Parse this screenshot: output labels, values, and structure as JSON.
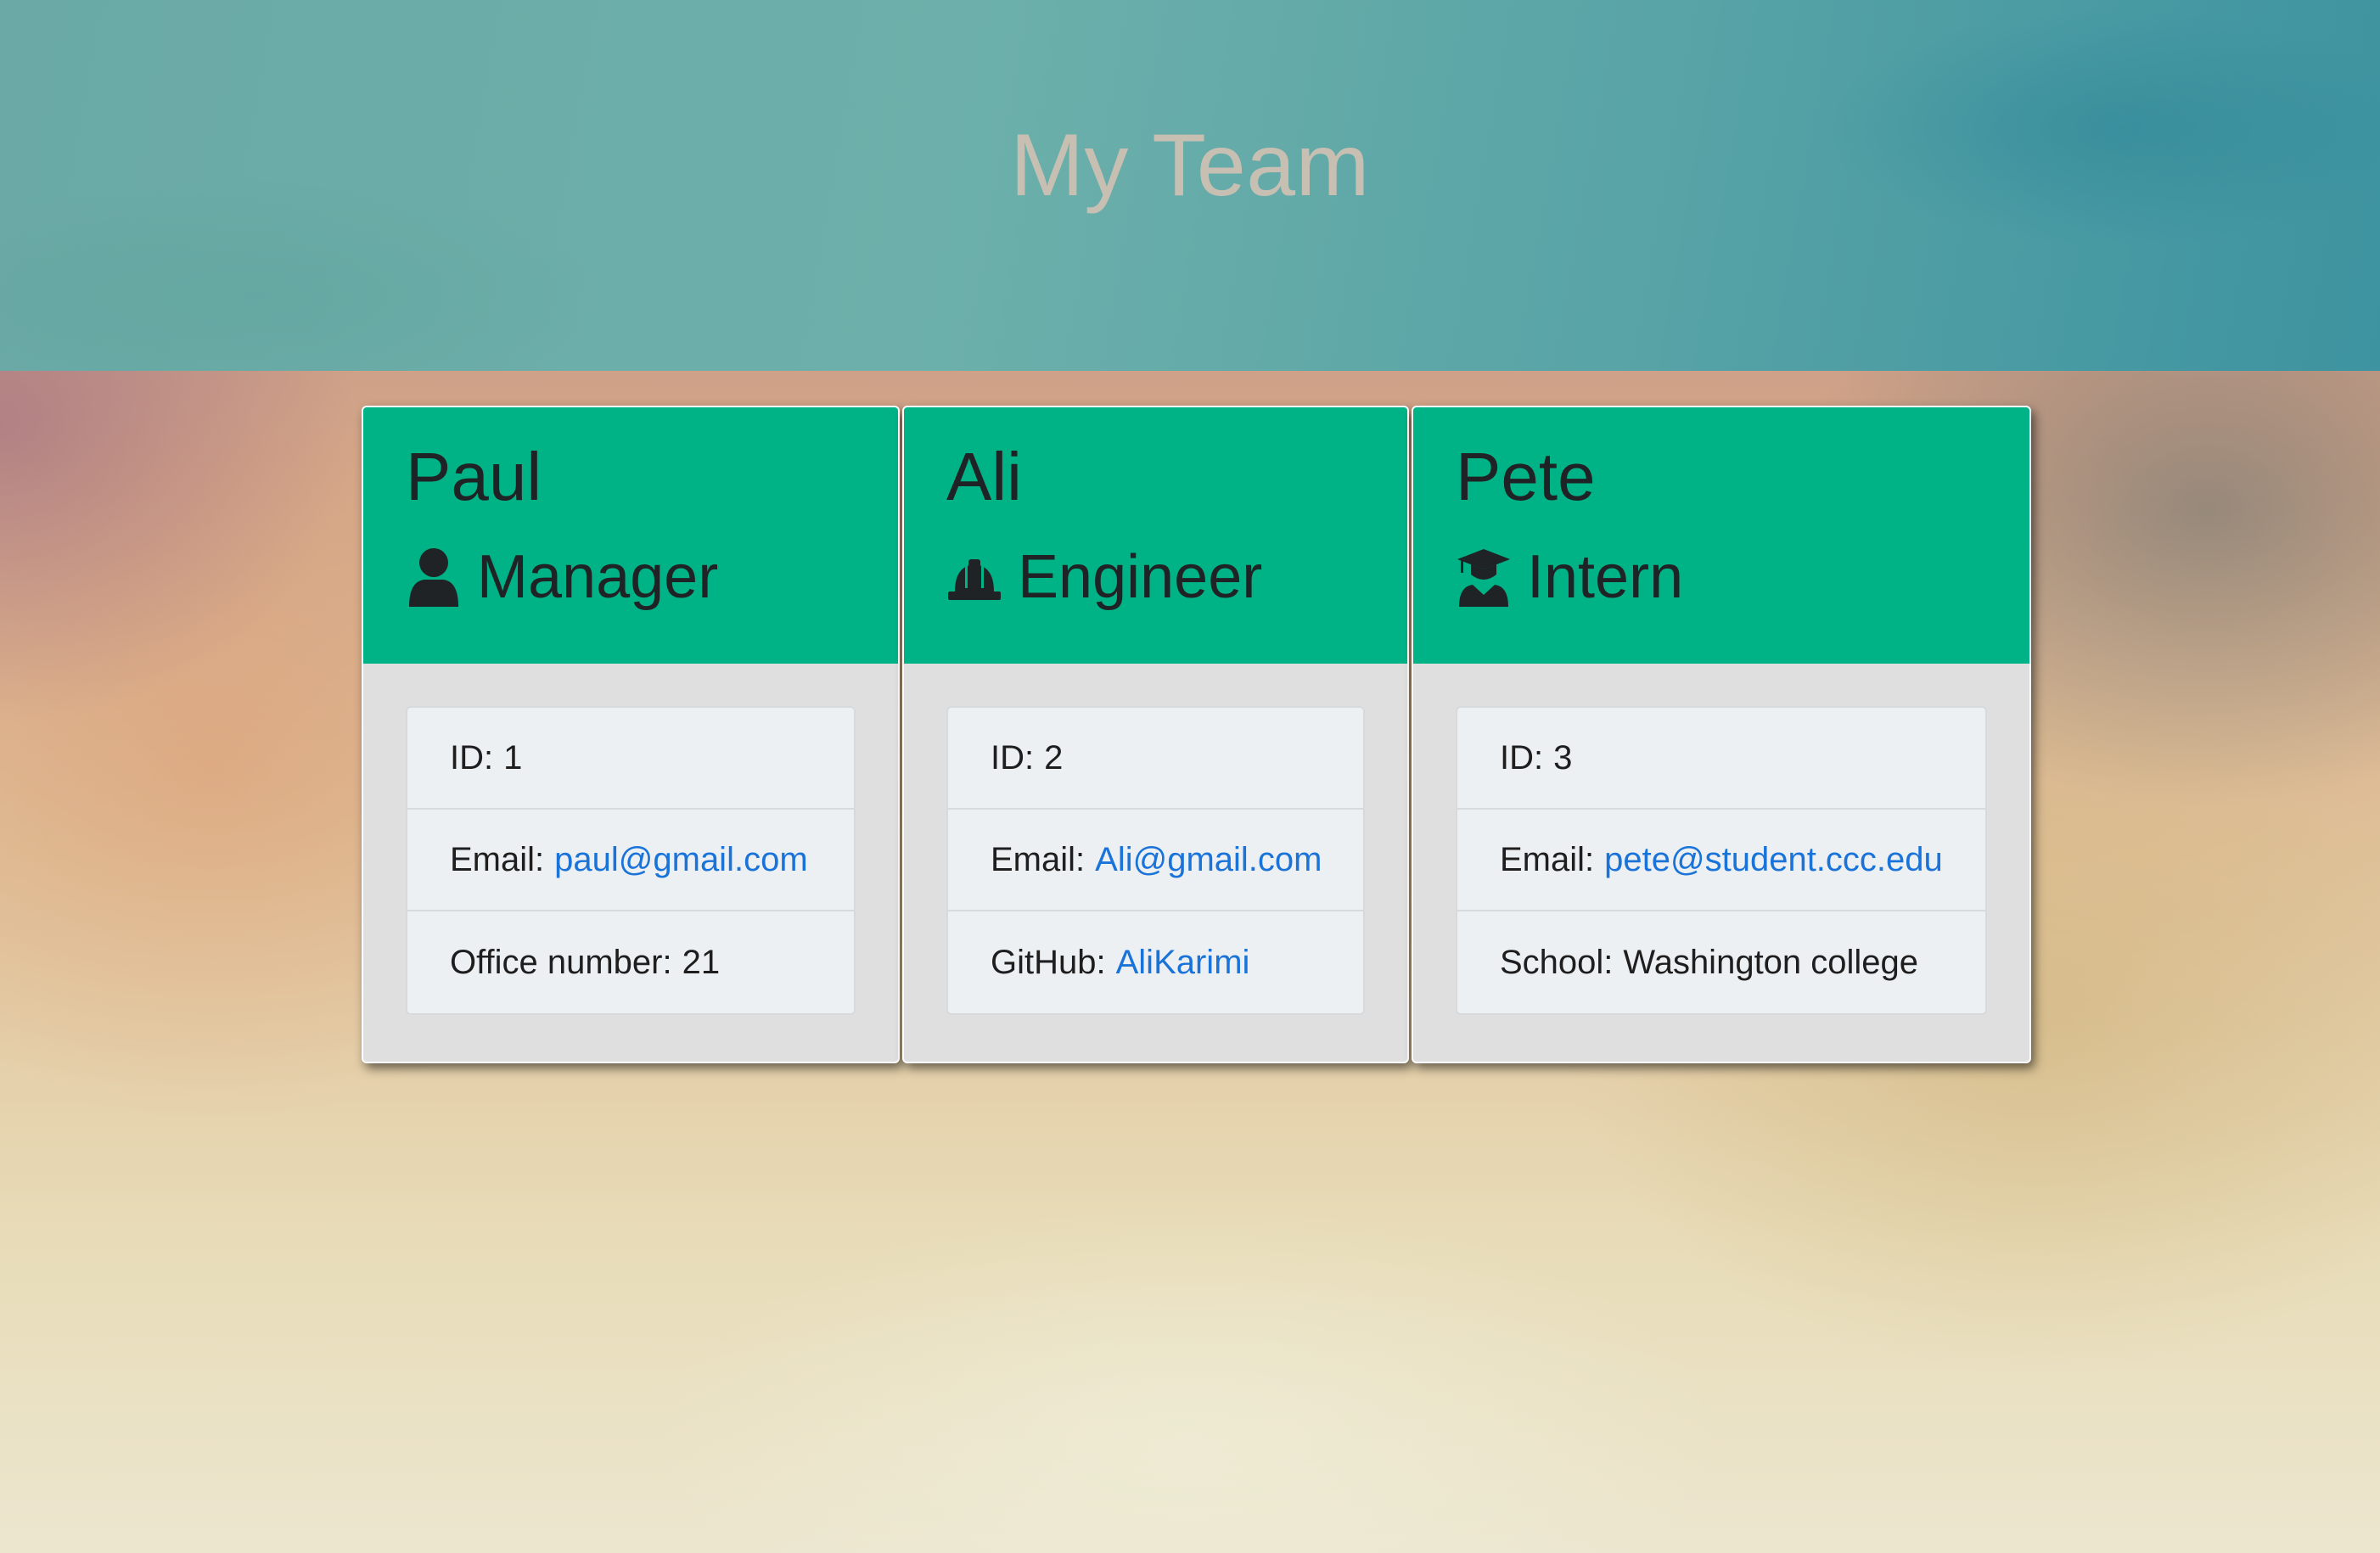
{
  "page": {
    "title": "My Team"
  },
  "team": [
    {
      "name": "Paul",
      "role": "Manager",
      "role_icon": "user-icon",
      "id_label": "ID:",
      "id_value": "1",
      "email_label": "Email:",
      "email": "paul@gmail.com",
      "extra_label": "Office number:",
      "extra_value": "21"
    },
    {
      "name": "Ali",
      "role": "Engineer",
      "role_icon": "hard-hat-icon",
      "id_label": "ID:",
      "id_value": "2",
      "email_label": "Email:",
      "email": "Ali@gmail.com",
      "extra_label": "GitHub:",
      "extra_value": "AliKarimi"
    },
    {
      "name": "Pete",
      "role": "Intern",
      "role_icon": "graduate-icon",
      "id_label": "ID:",
      "id_value": "3",
      "email_label": "Email:",
      "email": "pete@student.ccc.edu",
      "extra_label": "School:",
      "extra_value": "Washington college"
    }
  ],
  "colors": {
    "card_header": "#00b386",
    "link": "#1a73d9",
    "title": "#c8bfb3"
  }
}
